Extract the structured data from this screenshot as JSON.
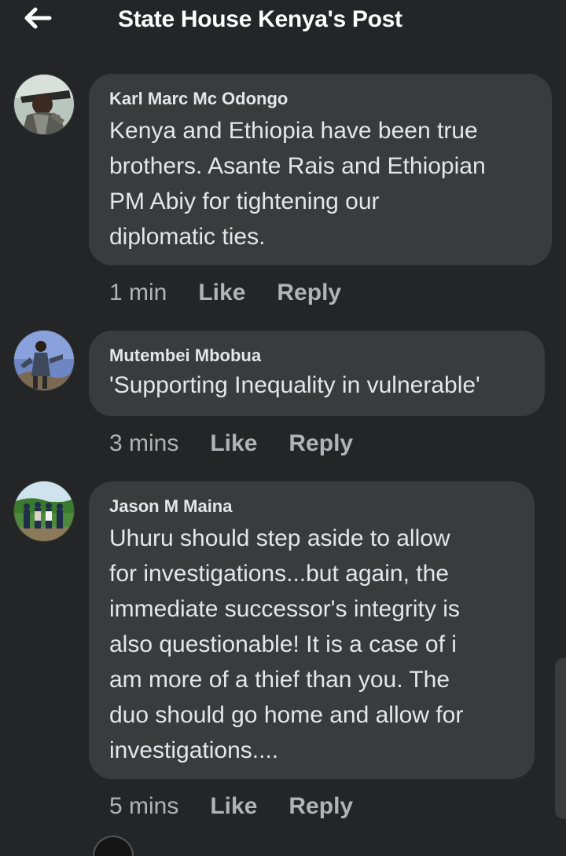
{
  "header": {
    "title": "State House Kenya's Post",
    "back_icon": "arrow-left-icon"
  },
  "comments": [
    {
      "author": "Karl Marc Mc Odongo",
      "text": "Kenya and Ethiopia have been true\nbrothers. Asante Rais and Ethiopian\nPM Abiy for tightening our\ndiplomatic ties.",
      "time": "1 min",
      "like_label": "Like",
      "reply_label": "Reply"
    },
    {
      "author": "Mutembei Mbobua",
      "text": "'Supporting Inequality in vulnerable'",
      "time": "3 mins",
      "like_label": "Like",
      "reply_label": "Reply"
    },
    {
      "author": "Jason M Maina",
      "text": "Uhuru should step aside to allow\nfor investigations...but again, the\nimmediate successor's integrity is\nalso questionable! It is a case of i\nam more of a thief than you. The\nduo should go home and allow for\ninvestigations....",
      "time": "5 mins",
      "like_label": "Like",
      "reply_label": "Reply"
    }
  ],
  "colors": {
    "background": "#242526",
    "bubble": "#3a3b3c",
    "primary_text": "#e4e6eb",
    "secondary_text": "#b0b3b8"
  }
}
